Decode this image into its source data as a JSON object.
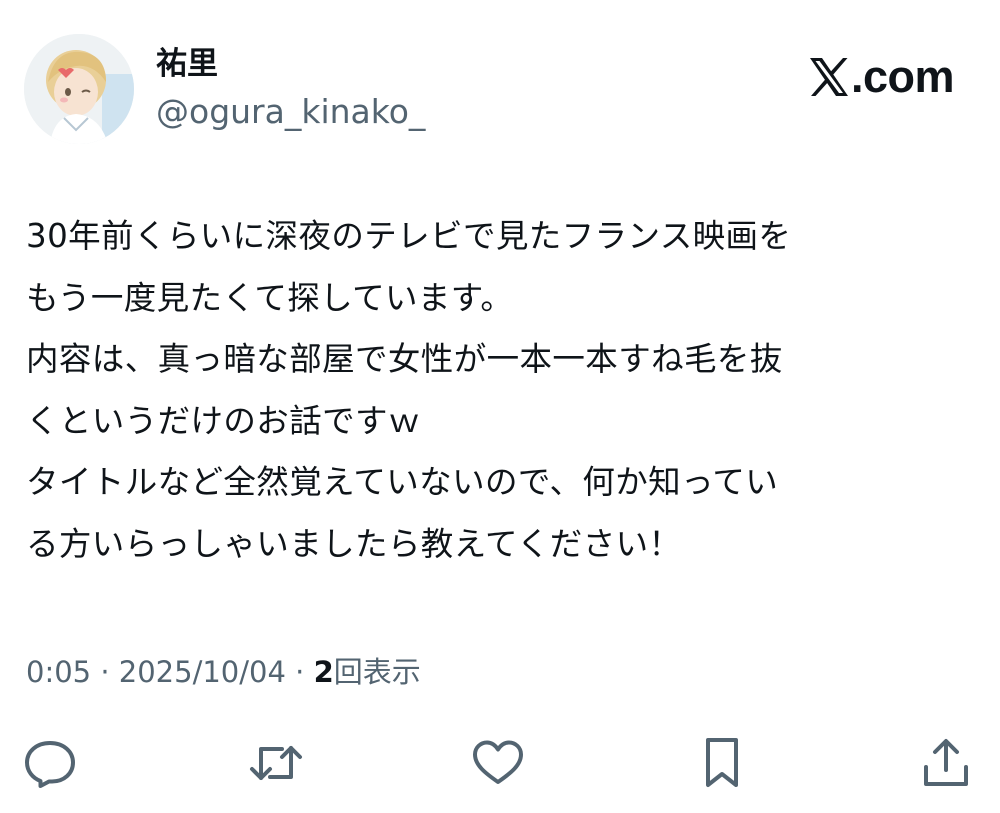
{
  "author": {
    "display_name": "祐里",
    "handle": "@ogura_kinako_",
    "avatar_icon": "avatar-illustration-icon"
  },
  "brand": {
    "mark": "X",
    "text": ".com"
  },
  "tweet": {
    "lines": [
      "30年前くらいに深夜のテレビで見たフランス映画を",
      "もう一度見たくて探しています。",
      "内容は、真っ暗な部屋で女性が一本一本すね毛を抜",
      "くというだけのお話ですｗ",
      "タイトルなど全然覚えていないので、何か知ってい",
      "る方いらっしゃいましたら教えてください！"
    ]
  },
  "meta": {
    "time": "0:05",
    "separator": " · ",
    "date": "2025/10/04",
    "view_count": "2",
    "view_label": "回表示"
  },
  "actions": [
    {
      "name": "reply",
      "icon": "reply-icon"
    },
    {
      "name": "repost",
      "icon": "repost-icon"
    },
    {
      "name": "like",
      "icon": "heart-icon"
    },
    {
      "name": "bookmark",
      "icon": "bookmark-icon"
    },
    {
      "name": "share",
      "icon": "share-icon"
    }
  ],
  "colors": {
    "text": "#0f1419",
    "secondary": "#536471",
    "background": "#ffffff"
  }
}
